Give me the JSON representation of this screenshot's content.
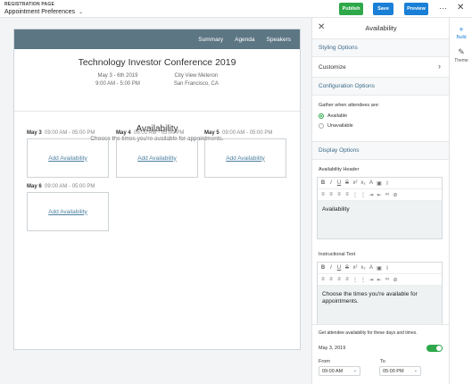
{
  "topbar": {
    "section_label": "REGISTRATION PAGE",
    "page_title": "Appointment Preferences",
    "publish": "Publish",
    "save": "Save",
    "preview": "Preview",
    "more": "···",
    "close": "✕"
  },
  "page": {
    "nav": [
      "Summary",
      "Agenda",
      "Speakers"
    ],
    "event_title": "Technology Investor Conference 2019",
    "date_range": "May 3 - 6th 2019",
    "time_range": "9:00 AM - 5:00 PM",
    "venue": "City View Meteron",
    "city": "San Francisco, CA",
    "availability_title": "Availability",
    "availability_sub": "Choose the times you're available for appointments.",
    "days": [
      {
        "date": "May 3",
        "time": "09:00 AM - 05:00 PM",
        "link": "Add Availability"
      },
      {
        "date": "May 4",
        "time": "09:00 AM - 05:00 PM",
        "link": "Add Availability"
      },
      {
        "date": "May 5",
        "time": "09:00 AM - 05:00 PM",
        "link": "Add Availability"
      },
      {
        "date": "May 6",
        "time": "09:00 AM - 05:00 PM",
        "link": "Add Availability"
      }
    ]
  },
  "panel": {
    "title": "Availability",
    "styling_options": "Styling Options",
    "customize": "Customize",
    "configuration_options": "Configuration Options",
    "gather_label": "Gather when attendees are:",
    "radio_available": "Available",
    "radio_unavailable": "Unavailable",
    "display_options": "Display Options",
    "availability_header_label": "Availability Header",
    "availability_header_value": "Availability",
    "instructional_text_label": "Instructional Text",
    "instructional_text_value": "Choose the times you're available for appointments.",
    "get_availability_note": "Get attendee availability for these days and times.",
    "day_date": "May 3, 2019",
    "from_label": "From",
    "to_label": "To",
    "from_value": "09:00 AM",
    "to_value": "05:00 PM"
  },
  "rail": {
    "build": "Build",
    "theme": "Theme"
  },
  "colors": {
    "publish": "#2ea84a",
    "primary": "#1a7fd6",
    "nav_bar": "#5d7684",
    "section_text": "#3a6b8a"
  }
}
